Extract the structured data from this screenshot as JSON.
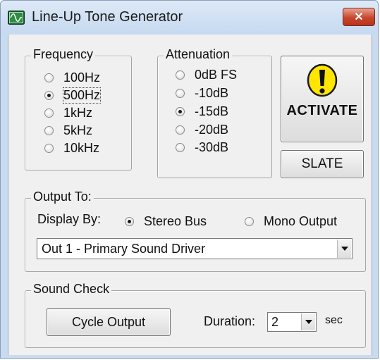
{
  "window": {
    "title": "Line-Up Tone Generator",
    "close_glyph": "✕"
  },
  "frequency": {
    "legend": "Frequency",
    "options": [
      "100Hz",
      "500Hz",
      "1kHz",
      "5kHz",
      "10kHz"
    ],
    "selected": "500Hz"
  },
  "attenuation": {
    "legend": "Attenuation",
    "options": [
      "0dB FS",
      "-10dB",
      "-15dB",
      "-20dB",
      "-30dB"
    ],
    "selected": "-15dB"
  },
  "buttons": {
    "activate": "ACTIVATE",
    "slate": "SLATE",
    "cycle_output": "Cycle Output"
  },
  "output": {
    "legend": "Output To:",
    "display_by_label": "Display By:",
    "options": [
      "Stereo Bus",
      "Mono Output"
    ],
    "selected": "Stereo Bus",
    "device": "Out 1 - Primary Sound Driver"
  },
  "sound_check": {
    "legend": "Sound Check",
    "duration_label": "Duration:",
    "duration_value": "2",
    "duration_unit": "sec"
  },
  "icons": {
    "app": "waveform-icon",
    "warning": "exclamation-icon"
  },
  "colors": {
    "warning_yellow": "#ffe600",
    "close_red": "#c8452c"
  }
}
